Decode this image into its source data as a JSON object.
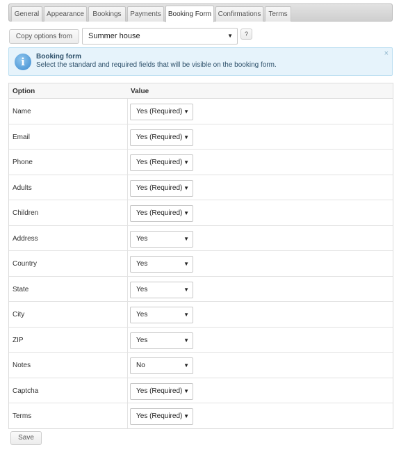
{
  "tabs": [
    {
      "label": "General",
      "active": false
    },
    {
      "label": "Appearance",
      "active": false
    },
    {
      "label": "Bookings",
      "active": false
    },
    {
      "label": "Payments",
      "active": false
    },
    {
      "label": "Booking Form",
      "active": true
    },
    {
      "label": "Confirmations",
      "active": false
    },
    {
      "label": "Terms",
      "active": false
    }
  ],
  "toolbar": {
    "copy_label": "Copy options from",
    "property_value": "Summer house",
    "help_label": "?"
  },
  "info": {
    "title": "Booking form",
    "text": "Select the standard and required fields that will be visible on the booking form.",
    "close": "×"
  },
  "table": {
    "headers": {
      "option": "Option",
      "value": "Value"
    },
    "rows": [
      {
        "option": "Name",
        "value": "Yes (Required)"
      },
      {
        "option": "Email",
        "value": "Yes (Required)"
      },
      {
        "option": "Phone",
        "value": "Yes (Required)"
      },
      {
        "option": "Adults",
        "value": "Yes (Required)"
      },
      {
        "option": "Children",
        "value": "Yes (Required)"
      },
      {
        "option": "Address",
        "value": "Yes"
      },
      {
        "option": "Country",
        "value": "Yes"
      },
      {
        "option": "State",
        "value": "Yes"
      },
      {
        "option": "City",
        "value": "Yes"
      },
      {
        "option": "ZIP",
        "value": "Yes"
      },
      {
        "option": "Notes",
        "value": "No"
      },
      {
        "option": "Captcha",
        "value": "Yes (Required)"
      },
      {
        "option": "Terms",
        "value": "Yes (Required)"
      }
    ]
  },
  "footer": {
    "save_label": "Save"
  }
}
